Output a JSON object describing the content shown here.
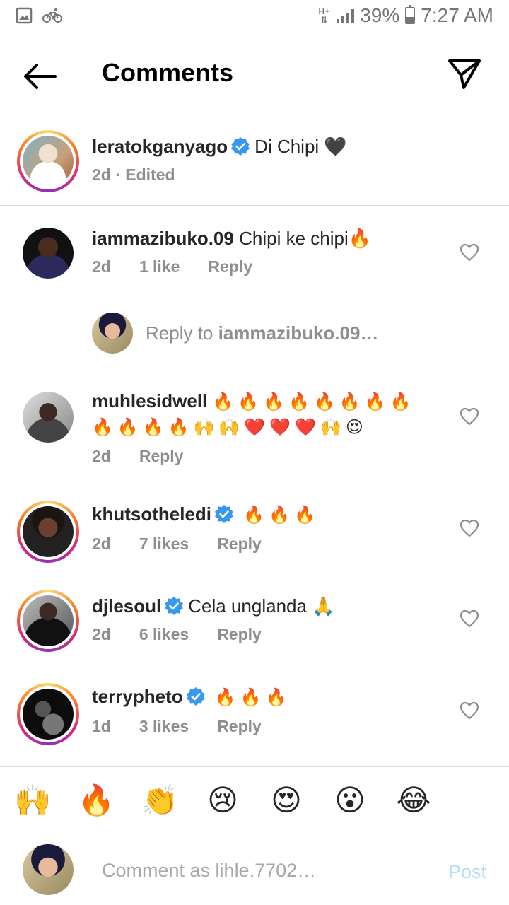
{
  "status_bar": {
    "network": "H+",
    "battery": "39%",
    "battery_level": 0.39,
    "time": "7:27 AM"
  },
  "header": {
    "title": "Comments"
  },
  "caption": {
    "username": "leratokganyago",
    "verified": true,
    "text": "Di Chipi 🖤",
    "meta": "2d · Edited"
  },
  "comments": [
    {
      "username": "iammazibuko.09",
      "verified": false,
      "text": "Chipi ke chipi🔥",
      "time": "2d",
      "likes": "1 like",
      "reply": "Reply"
    },
    {
      "username": "muhlesidwell",
      "verified": false,
      "text": "🔥🔥🔥🔥🔥🔥🔥🔥🔥🔥🔥🔥🙌🙌❤️❤️❤️🙌😍",
      "time": "2d",
      "likes": "",
      "reply": "Reply"
    },
    {
      "username": "khutsotheledi",
      "verified": true,
      "text": "🔥🔥🔥",
      "time": "2d",
      "likes": "7 likes",
      "reply": "Reply"
    },
    {
      "username": "djlesoul",
      "verified": true,
      "text": "Cela unglanda 🙏",
      "time": "2d",
      "likes": "6 likes",
      "reply": "Reply"
    },
    {
      "username": "terrypheto",
      "verified": true,
      "text": "🔥🔥🔥",
      "time": "1d",
      "likes": "3 likes",
      "reply": "Reply"
    }
  ],
  "reply_to": {
    "prefix": "Reply to ",
    "username": "iammazibuko.09…"
  },
  "quick_emojis": [
    "🙌",
    "🔥",
    "👏",
    "😢",
    "😍",
    "😮",
    "😂"
  ],
  "composer": {
    "placeholder": "Comment as lihle.7702…",
    "post_label": "Post"
  },
  "colors": {
    "verified": "#3897f0",
    "meta": "#8e8e8e",
    "post_disabled": "#b2dffc"
  }
}
